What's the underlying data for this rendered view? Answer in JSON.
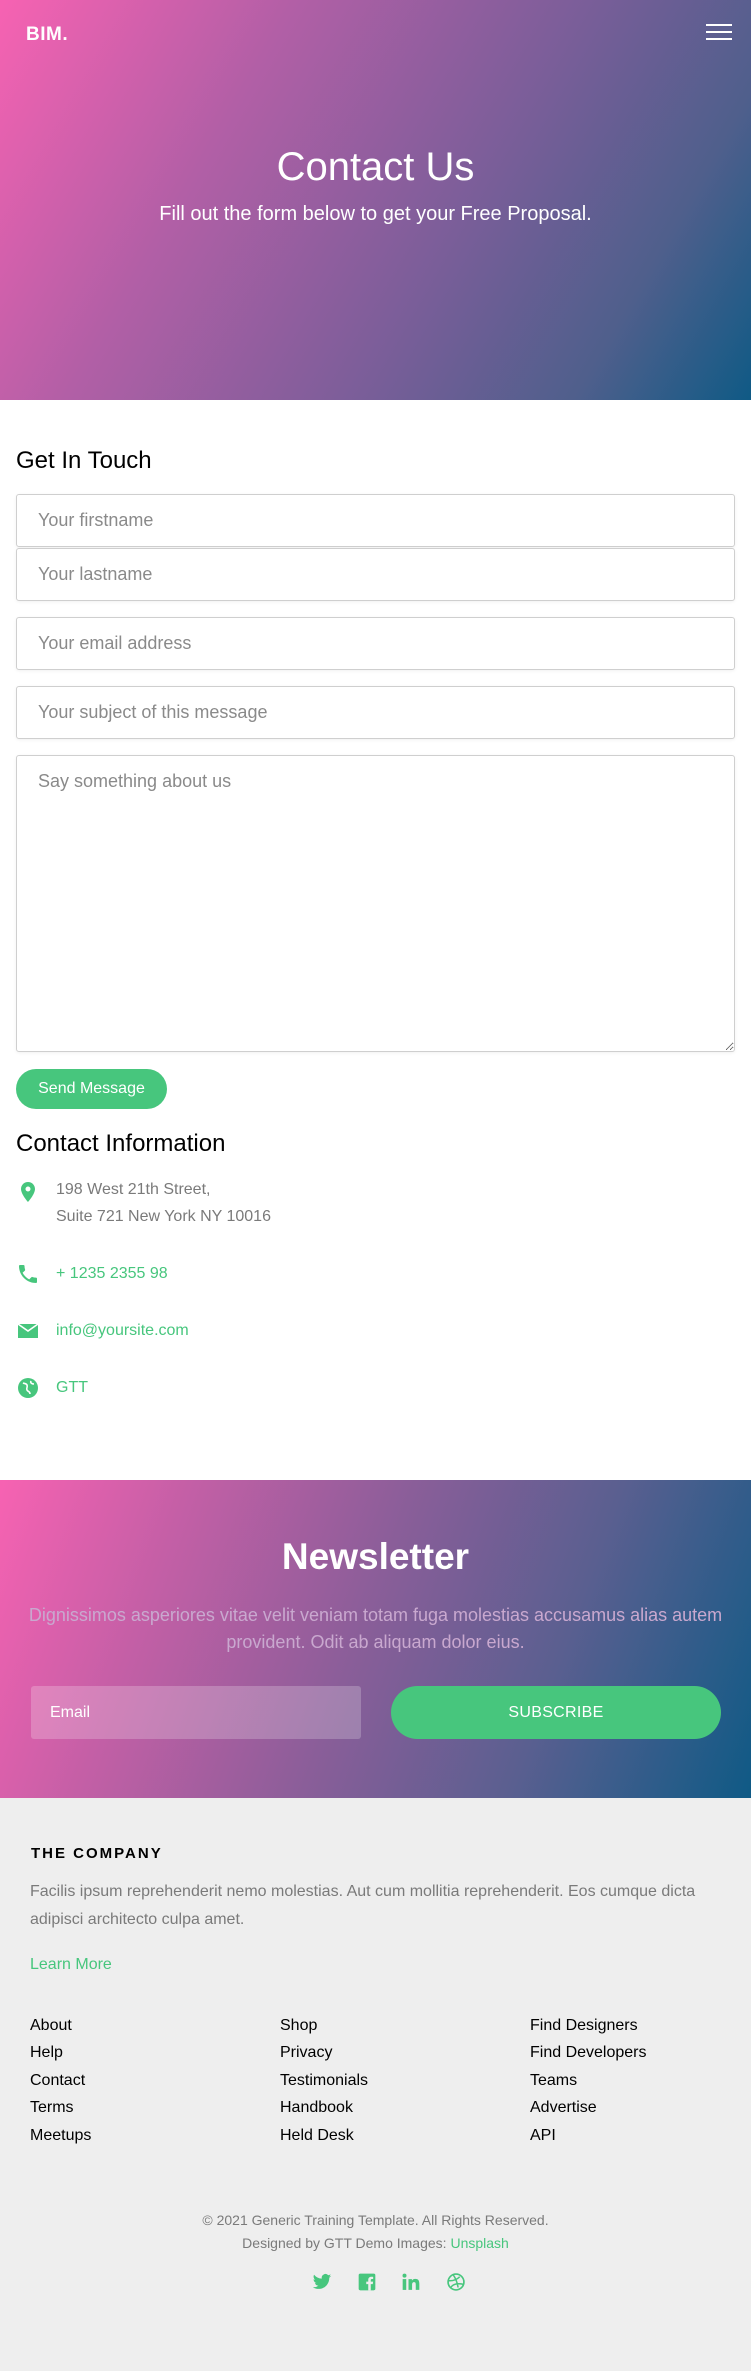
{
  "header": {
    "logo": "BIM.",
    "menu_icon": "hamburger-menu-icon"
  },
  "hero": {
    "title": "Contact Us",
    "subtitle": "Fill out the form below to get your Free Proposal."
  },
  "form": {
    "title": "Get In Touch",
    "firstname_placeholder": "Your firstname",
    "lastname_placeholder": "Your lastname",
    "email_placeholder": "Your email address",
    "subject_placeholder": "Your subject of this message",
    "message_placeholder": "Say something about us",
    "send_label": "Send Message"
  },
  "contact_info": {
    "title": "Contact Information",
    "address_line1": "198 West 21th Street,",
    "address_line2": "Suite 721 New York NY 10016",
    "phone": "+ 1235 2355 98",
    "email": "info@yoursite.com",
    "website": "GTT",
    "icons": [
      "map-pin-icon",
      "phone-icon",
      "envelope-icon",
      "globe-icon"
    ]
  },
  "newsletter": {
    "title": "Newsletter",
    "text": "Dignissimos asperiores vitae velit veniam totam fuga molestias accusamus alias autem provident. Odit ab aliquam dolor eius.",
    "email_placeholder": "Email",
    "subscribe_label": "SUBSCRIBE"
  },
  "footer": {
    "heading": "THE COMPANY",
    "description": "Facilis ipsum reprehenderit nemo molestias. Aut cum mollitia reprehenderit. Eos cumque dicta adipisci architecto culpa amet.",
    "learn_more": "Learn More",
    "col1": [
      "About",
      "Help",
      "Contact",
      "Terms",
      "Meetups"
    ],
    "col2": [
      "Shop",
      "Privacy",
      "Testimonials",
      "Handbook",
      "Held Desk"
    ],
    "col3": [
      "Find Designers",
      "Find Developers",
      "Teams",
      "Advertise",
      "API"
    ],
    "copyright": "© 2021 Generic Training Template. All Rights Reserved.",
    "designed_prefix": "Designed by GTT Demo Images: ",
    "designed_link": "Unsplash",
    "social_icons": [
      "twitter-icon",
      "facebook-icon",
      "linkedin-icon",
      "dribbble-icon"
    ]
  },
  "colors": {
    "accent": "#47c67d",
    "gradient_start": "#f762b2",
    "gradient_end": "#0f5a85",
    "footer_bg": "#eeeeee"
  }
}
